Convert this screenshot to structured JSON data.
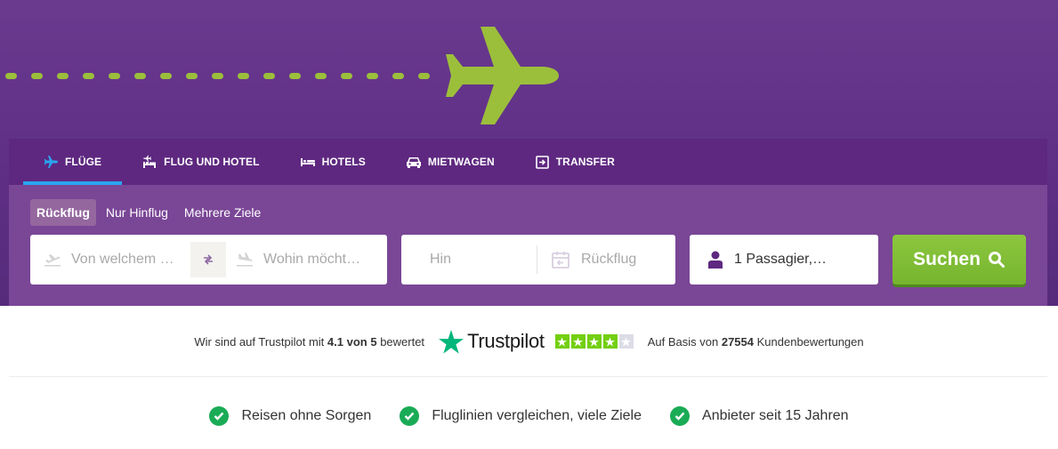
{
  "tabs": [
    {
      "label": "FLÜGE",
      "icon": "plane-icon",
      "active": true
    },
    {
      "label": "FLUG UND HOTEL",
      "icon": "flight-hotel-icon",
      "active": false
    },
    {
      "label": "HOTELS",
      "icon": "bed-icon",
      "active": false
    },
    {
      "label": "MIETWAGEN",
      "icon": "car-icon",
      "active": false
    },
    {
      "label": "TRANSFER",
      "icon": "transfer-icon",
      "active": false
    }
  ],
  "trip_types": [
    {
      "label": "Rückflug",
      "active": true
    },
    {
      "label": "Nur Hinflug",
      "active": false
    },
    {
      "label": "Mehrere Ziele",
      "active": false
    }
  ],
  "search": {
    "from_placeholder": "Von welchem …",
    "to_placeholder": "Wohin möcht…",
    "depart_placeholder": "Hin",
    "return_placeholder": "Rückflug",
    "passengers_value": "1 Passagier,…",
    "submit_label": "Suchen"
  },
  "trustpilot": {
    "prefix": "Wir sind auf Trustpilot mit",
    "rating": "4.1 von 5",
    "suffix": "bewertet",
    "brand": "Trustpilot",
    "stars_filled": 4,
    "stars_total": 5,
    "reviews_prefix": "Auf Basis von",
    "reviews_count": "27554",
    "reviews_suffix": "Kundenbewertungen"
  },
  "usps": [
    {
      "label": "Reisen ohne Sorgen"
    },
    {
      "label": "Fluglinien vergleichen, viele Ziele"
    },
    {
      "label": "Anbieter seit 15 Jahren"
    }
  ],
  "colors": {
    "hero": "#5f2f86",
    "tabbar": "#5e2880",
    "panel": "#7a4696",
    "active_tab_underline": "#29a6f0",
    "plane": "#9cbf3b",
    "search_button": "#7fbd34",
    "trustpilot_green": "#00b67a",
    "check_green": "#1aab56"
  }
}
